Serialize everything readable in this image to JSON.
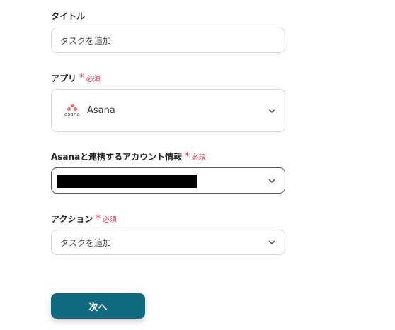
{
  "title_field": {
    "label": "タイトル",
    "value": "タスクを追加"
  },
  "app_field": {
    "label": "アプリ",
    "required": "必須",
    "logo_text": "asana",
    "value": "Asana"
  },
  "account_field": {
    "label": "Asanaと連携するアカウント情報",
    "required": "必須"
  },
  "action_field": {
    "label": "アクション",
    "required": "必須",
    "value": "タスクを追加"
  },
  "next_button": {
    "label": "次へ"
  },
  "colors": {
    "required": "#e0314b",
    "button": "#0f6a80",
    "asana": "#f06a6a"
  },
  "icons": {
    "chevron": "chevron-down-icon",
    "required_mark": "asterisk-icon",
    "app_logo": "asana-logo"
  }
}
